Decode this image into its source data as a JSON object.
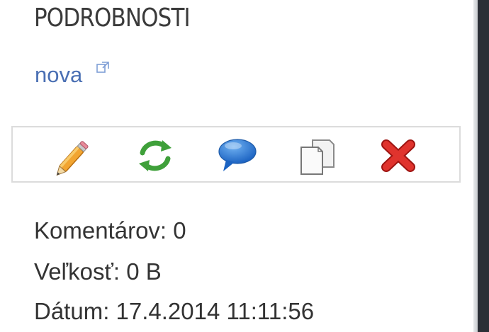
{
  "details": {
    "title": "PODROBNOSTI",
    "link_text": "nova"
  },
  "toolbar": {
    "buttons": [
      {
        "name": "edit",
        "icon": "pencil-icon"
      },
      {
        "name": "refresh",
        "icon": "refresh-arrows-icon"
      },
      {
        "name": "comment",
        "icon": "speech-bubble-icon"
      },
      {
        "name": "copy",
        "icon": "copy-documents-icon"
      },
      {
        "name": "delete",
        "icon": "red-x-icon"
      }
    ]
  },
  "meta": {
    "comments": "Komentárov: 0",
    "size": "Veľkosť: 0 B",
    "date": "Dátum: 17.4.2014 11:11:56"
  },
  "colors": {
    "link": "#4a6fb3",
    "text": "#333333",
    "toolbar_border": "#dcdcdc",
    "refresh_green": "#3fa03a",
    "comment_blue": "#2a78d4",
    "delete_red": "#d8231f",
    "pencil_orange": "#f0a030"
  }
}
